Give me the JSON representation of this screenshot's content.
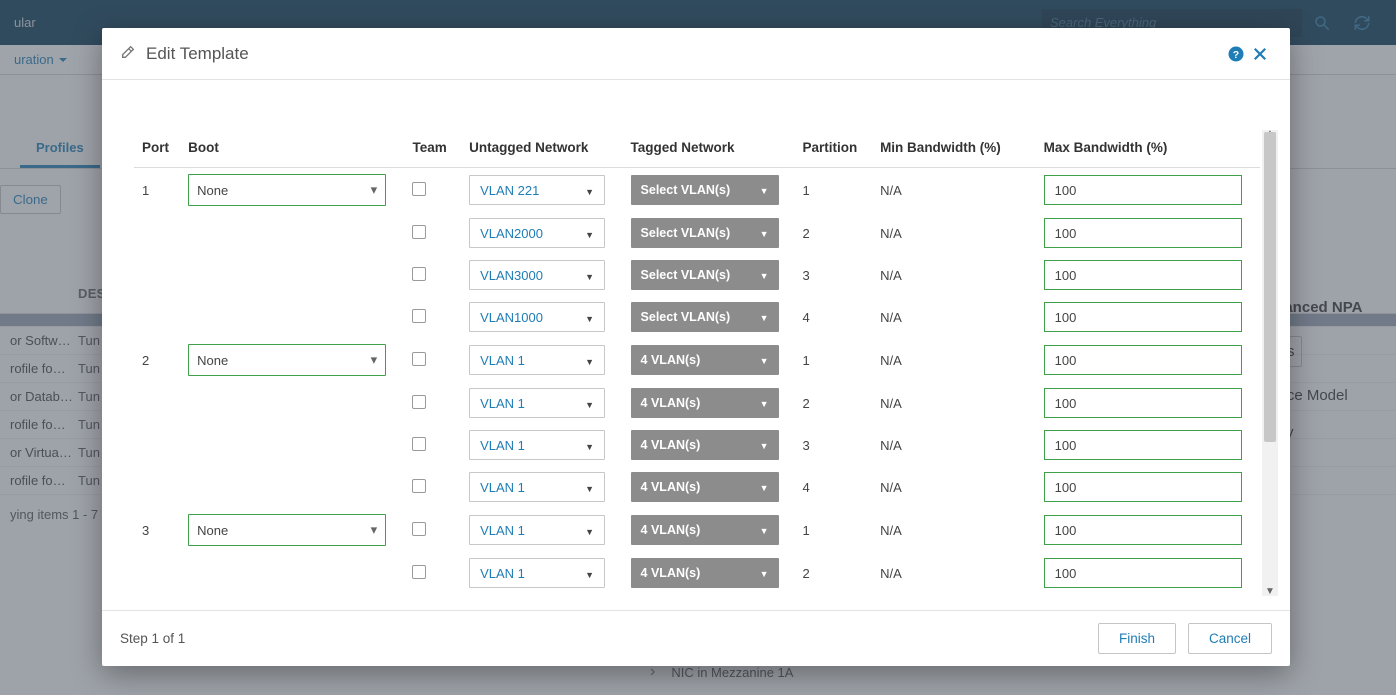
{
  "bg": {
    "app_title_frag": "ular",
    "search_placeholder": "Search Everything",
    "menu_item": "uration",
    "tab": "Profiles",
    "btn_clone": "Clone",
    "col_des": "DES",
    "rows": [
      {
        "c1": "",
        "c2": "",
        "sel": true
      },
      {
        "c1": "or Softw…",
        "c2": "Tun"
      },
      {
        "c1": "rofile fo…",
        "c2": "Tun"
      },
      {
        "c1": "or Datab…",
        "c2": "Tun"
      },
      {
        "c1": "rofile fo…",
        "c2": "Tun"
      },
      {
        "c1": "or Virtua…",
        "c2": "Tun"
      },
      {
        "c1": "rofile fo…",
        "c2": "Tun"
      }
    ],
    "paging": "ying items 1 - 7",
    "right1": "vanced NPA",
    "right_chip": "s",
    "right2": "vice Model",
    "right3": "By",
    "mezz": "NIC in Mezzanine 1A"
  },
  "modal": {
    "title": "Edit Template",
    "headers": {
      "port": "Port",
      "boot": "Boot",
      "team": "Team",
      "untag": "Untagged Network",
      "tag": "Tagged Network",
      "part": "Partition",
      "min": "Min Bandwidth (%)",
      "max": "Max Bandwidth (%)"
    },
    "ports": [
      {
        "num": "1",
        "boot": "None",
        "rows": [
          {
            "untag": "VLAN 221",
            "tag": "Select VLAN(s)",
            "part": "1",
            "min": "N/A",
            "max": "100"
          },
          {
            "untag": "VLAN2000",
            "tag": "Select VLAN(s)",
            "part": "2",
            "min": "N/A",
            "max": "100"
          },
          {
            "untag": "VLAN3000",
            "tag": "Select VLAN(s)",
            "part": "3",
            "min": "N/A",
            "max": "100"
          },
          {
            "untag": "VLAN1000",
            "tag": "Select VLAN(s)",
            "part": "4",
            "min": "N/A",
            "max": "100"
          }
        ]
      },
      {
        "num": "2",
        "boot": "None",
        "rows": [
          {
            "untag": "VLAN 1",
            "tag": "4 VLAN(s)",
            "part": "1",
            "min": "N/A",
            "max": "100"
          },
          {
            "untag": "VLAN 1",
            "tag": "4 VLAN(s)",
            "part": "2",
            "min": "N/A",
            "max": "100"
          },
          {
            "untag": "VLAN 1",
            "tag": "4 VLAN(s)",
            "part": "3",
            "min": "N/A",
            "max": "100"
          },
          {
            "untag": "VLAN 1",
            "tag": "4 VLAN(s)",
            "part": "4",
            "min": "N/A",
            "max": "100"
          }
        ]
      },
      {
        "num": "3",
        "boot": "None",
        "rows": [
          {
            "untag": "VLAN 1",
            "tag": "4 VLAN(s)",
            "part": "1",
            "min": "N/A",
            "max": "100"
          },
          {
            "untag": "VLAN 1",
            "tag": "4 VLAN(s)",
            "part": "2",
            "min": "N/A",
            "max": "100"
          }
        ]
      }
    ],
    "step": "Step 1 of 1",
    "finish": "Finish",
    "cancel": "Cancel"
  }
}
